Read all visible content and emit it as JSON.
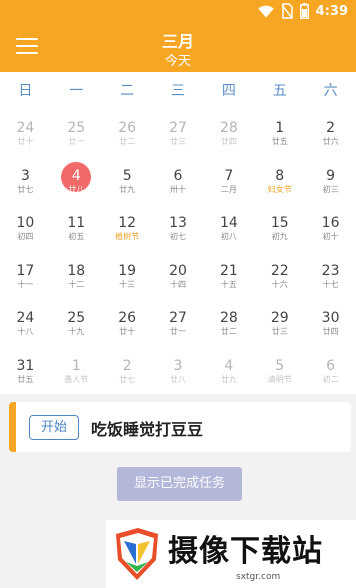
{
  "status_bar": {
    "time": "4:39",
    "icons": [
      "wifi-icon",
      "no-sim-icon",
      "battery-icon"
    ]
  },
  "app_bar": {
    "title": "三月",
    "subtitle": "今天",
    "menu_icon": "hamburger-menu-icon"
  },
  "colors": {
    "accent": "#f6a623",
    "today": "#f06a6a",
    "weekday": "#5a8fc6",
    "festival": "#f0a32a",
    "button_blue": "#4a86c5",
    "done_button": "#b3b7d9"
  },
  "calendar": {
    "weekdays": [
      "日",
      "一",
      "二",
      "三",
      "四",
      "五",
      "六"
    ],
    "weeks": [
      [
        {
          "day": "24",
          "lunar": "廿十",
          "muted": true
        },
        {
          "day": "25",
          "lunar": "廿一",
          "muted": true
        },
        {
          "day": "26",
          "lunar": "廿二",
          "muted": true
        },
        {
          "day": "27",
          "lunar": "廿三",
          "muted": true
        },
        {
          "day": "28",
          "lunar": "廿四",
          "muted": true
        },
        {
          "day": "1",
          "lunar": "廿五"
        },
        {
          "day": "2",
          "lunar": "廿六"
        }
      ],
      [
        {
          "day": "3",
          "lunar": "廿七"
        },
        {
          "day": "4",
          "lunar": "廿八",
          "today": true
        },
        {
          "day": "5",
          "lunar": "廿九"
        },
        {
          "day": "6",
          "lunar": "卅十"
        },
        {
          "day": "7",
          "lunar": "二月"
        },
        {
          "day": "8",
          "lunar": "妇女节",
          "festival": true
        },
        {
          "day": "9",
          "lunar": "初三"
        }
      ],
      [
        {
          "day": "10",
          "lunar": "初四"
        },
        {
          "day": "11",
          "lunar": "初五"
        },
        {
          "day": "12",
          "lunar": "植树节",
          "festival": true
        },
        {
          "day": "13",
          "lunar": "初七"
        },
        {
          "day": "14",
          "lunar": "初八"
        },
        {
          "day": "15",
          "lunar": "初九"
        },
        {
          "day": "16",
          "lunar": "初十"
        }
      ],
      [
        {
          "day": "17",
          "lunar": "十一"
        },
        {
          "day": "18",
          "lunar": "十二"
        },
        {
          "day": "19",
          "lunar": "十三"
        },
        {
          "day": "20",
          "lunar": "十四"
        },
        {
          "day": "21",
          "lunar": "十五"
        },
        {
          "day": "22",
          "lunar": "十六"
        },
        {
          "day": "23",
          "lunar": "十七"
        }
      ],
      [
        {
          "day": "24",
          "lunar": "十八"
        },
        {
          "day": "25",
          "lunar": "十九"
        },
        {
          "day": "26",
          "lunar": "廿十"
        },
        {
          "day": "27",
          "lunar": "廿一"
        },
        {
          "day": "28",
          "lunar": "廿二"
        },
        {
          "day": "29",
          "lunar": "廿三"
        },
        {
          "day": "30",
          "lunar": "廿四"
        }
      ],
      [
        {
          "day": "31",
          "lunar": "廿五"
        },
        {
          "day": "1",
          "lunar": "愚人节",
          "muted": true
        },
        {
          "day": "2",
          "lunar": "廿七",
          "muted": true
        },
        {
          "day": "3",
          "lunar": "廿八",
          "muted": true
        },
        {
          "day": "4",
          "lunar": "廿九",
          "muted": true
        },
        {
          "day": "5",
          "lunar": "清明节",
          "muted": true
        },
        {
          "day": "6",
          "lunar": "初二",
          "muted": true
        }
      ]
    ]
  },
  "task": {
    "start_label": "开始",
    "title": "吃饭睡觉打豆豆"
  },
  "show_done_label": "显示已完成任务",
  "watermark": {
    "text": "摄像下载站",
    "url": "sxtgr.com"
  }
}
